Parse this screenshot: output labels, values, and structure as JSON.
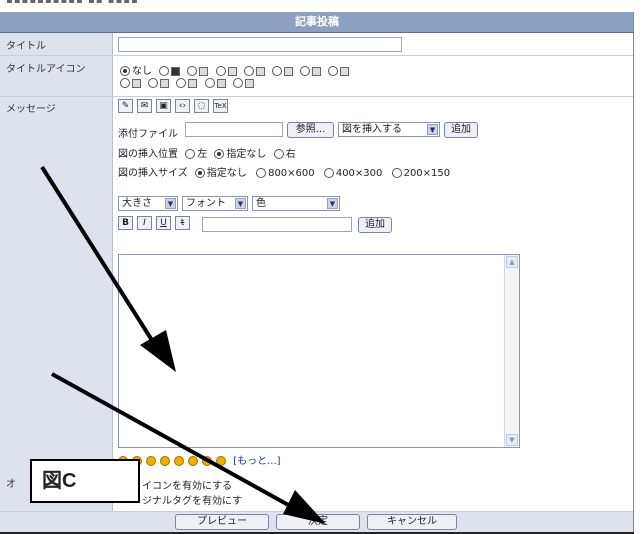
{
  "header": {
    "title": "記事投稿"
  },
  "labels": {
    "title": "タイトル",
    "title_icon": "タイトルアイコン",
    "message": "メッセージ",
    "options_prefix": "オ"
  },
  "title_icon": {
    "none_label": "なし"
  },
  "attach": {
    "label": "添付ファイル",
    "browse": "参照...",
    "insert_select": "図を挿入する",
    "add": "追加"
  },
  "position": {
    "label": "図の挿入位置",
    "left": "左",
    "none": "指定なし",
    "right": "右"
  },
  "size": {
    "label": "図の挿入サイズ",
    "none": "指定なし",
    "s1": "800×600",
    "s2": "400×300",
    "s3": "200×150"
  },
  "format": {
    "size_select": "大きさ",
    "font_select": "フォント",
    "color_select": "色",
    "bold": "B",
    "italic": "I",
    "underline": "U",
    "strike": "t",
    "add": "追加"
  },
  "emoji": {
    "more": "[もっと...]"
  },
  "options": {
    "opt1": "イコンを有効にする",
    "opt2": "ジナルタグを有効にす"
  },
  "buttons": {
    "preview": "プレビュー",
    "submit": "決定",
    "cancel": "キャンセル"
  },
  "callout": {
    "text": "図C"
  },
  "colors": {
    "header": "#8ca0c0",
    "label_bg": "#dde2ec"
  }
}
